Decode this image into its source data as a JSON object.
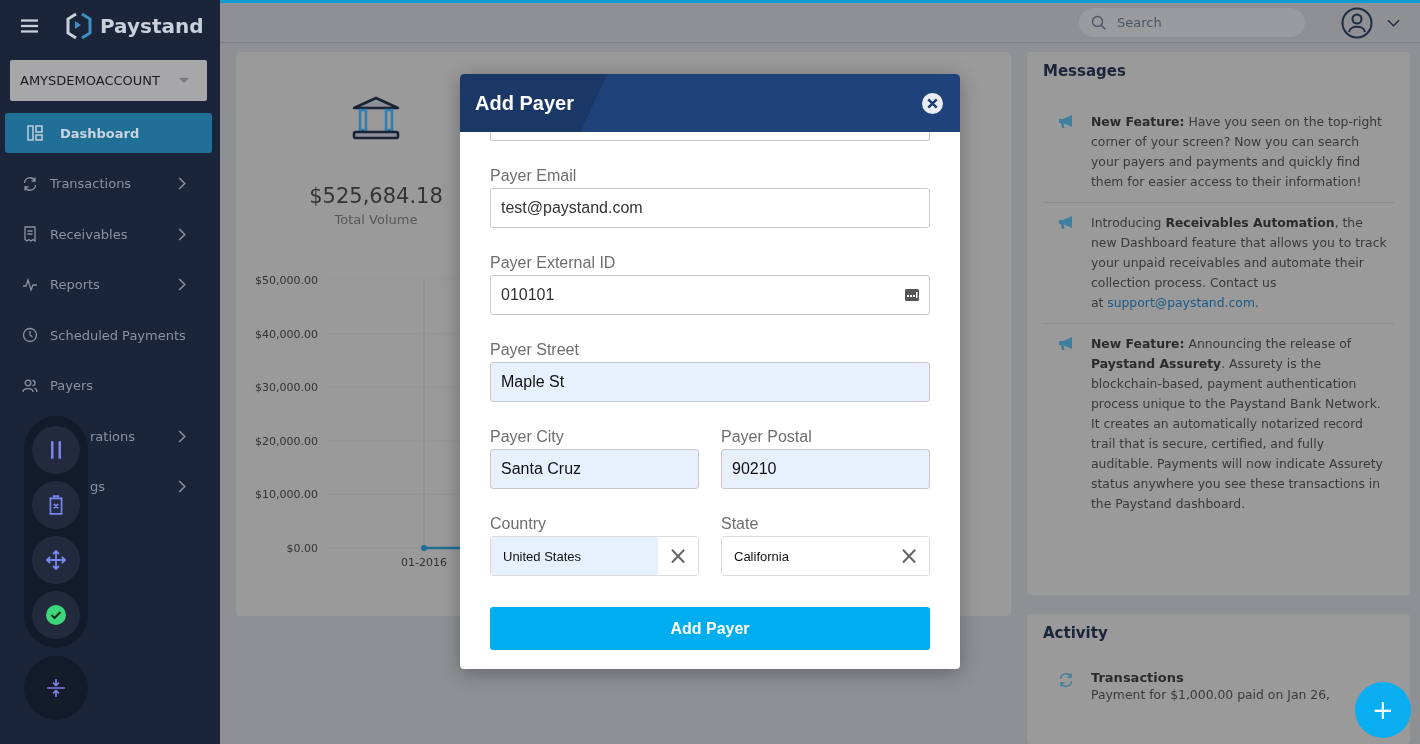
{
  "brand": {
    "name": "Paystand"
  },
  "account": {
    "value": "AMYSDEMOACCOUNT"
  },
  "sidebar": {
    "items": [
      {
        "label": "Dashboard",
        "selected": true,
        "chevron": false,
        "covered": false
      },
      {
        "label": "Transactions",
        "selected": false,
        "chevron": true,
        "covered": false
      },
      {
        "label": "Receivables",
        "selected": false,
        "chevron": true,
        "covered": false
      },
      {
        "label": "Reports",
        "selected": false,
        "chevron": true,
        "covered": false
      },
      {
        "label": "Scheduled Payments",
        "selected": false,
        "chevron": false,
        "covered": false
      },
      {
        "label": "Payers",
        "selected": false,
        "chevron": false,
        "covered": false
      },
      {
        "label": "rations",
        "selected": false,
        "chevron": true,
        "covered": true
      },
      {
        "label": "gs",
        "selected": false,
        "chevron": true,
        "covered": true
      }
    ]
  },
  "search": {
    "placeholder": "Search"
  },
  "summary": {
    "amount": "$525,684.18",
    "caption": "Total Volume"
  },
  "chart_data": {
    "type": "line",
    "categories": [
      "01-2016"
    ],
    "series": [
      {
        "color": "#1f6f96",
        "marker": "circle",
        "values": [
          0
        ]
      }
    ],
    "ylim": [
      0,
      50000
    ],
    "yticks": [
      {
        "value": 0,
        "label": "$0.00"
      },
      {
        "value": 10000,
        "label": "$10,000.00"
      },
      {
        "value": 20000,
        "label": "$20,000.00"
      },
      {
        "value": 30000,
        "label": "$30,000.00"
      },
      {
        "value": 40000,
        "label": "$40,000.00"
      },
      {
        "value": 50000,
        "label": "$50,000.00"
      }
    ]
  },
  "messages": {
    "title": "Messages",
    "items": [
      {
        "text": "**New Feature:** Have you seen on the top-right corner of your screen? Now you can search your payers and payments and quickly find them for easier access to their information!"
      },
      {
        "text": "Introducing **Receivables Automation**, the new Dashboard feature that allows you to track your unpaid receivables and automate their collection process. Contact us at",
        "link": "support@paystand.com",
        "after": "."
      },
      {
        "text": "**New Feature:** Announcing the release of **Paystand Assurety**. Assurety is the blockchain-based, payment authentication process unique to the Paystand Bank Network. It creates an automatically notarized record trail that is secure, certified, and fully auditable. Payments will now indicate Assurety status anywhere you see these transactions in the Paystand dashboard."
      }
    ]
  },
  "activity": {
    "title": "Activity",
    "items": [
      {
        "title": "Transactions",
        "text": "Payment for $1,000.00 paid on Jan 26,"
      }
    ]
  },
  "modal": {
    "title": "Add Payer",
    "fields": [
      {
        "kind": "text",
        "label": "Payer Email",
        "value": "test@paystand.com",
        "autofilled": false
      },
      {
        "kind": "id",
        "label": "Payer External ID",
        "value": "010101",
        "autofilled": false
      },
      {
        "kind": "text",
        "label": "Payer Street",
        "value": "Maple St",
        "autofilled": true
      },
      {
        "kind": "pair",
        "items": [
          {
            "label": "Payer City",
            "value": "Santa Cruz",
            "autofilled": true
          },
          {
            "label": "Payer Postal",
            "value": "90210",
            "autofilled": true
          }
        ]
      },
      {
        "kind": "selects",
        "items": [
          {
            "label": "Country",
            "value": "United States",
            "autofilled": true,
            "clear": "×"
          },
          {
            "label": "State",
            "value": "California",
            "autofilled": false,
            "clear": "×"
          }
        ]
      }
    ],
    "submit": "Add Payer"
  },
  "fab": {
    "label": "+"
  }
}
